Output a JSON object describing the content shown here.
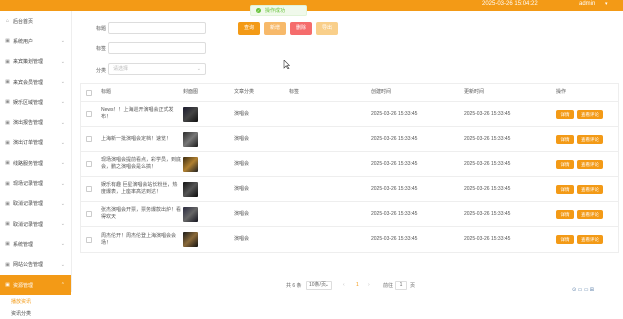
{
  "header": {
    "timestamp": "2025-03-26 15:04:22",
    "user": "admin",
    "caret": "▾"
  },
  "toast": {
    "icon": "✓",
    "message": "操作成功"
  },
  "sidebar": {
    "items": [
      {
        "icon": "⌂",
        "label": "后台首页"
      },
      {
        "icon": "▣",
        "label": "系统用户"
      },
      {
        "icon": "▣",
        "label": "来宾策划管理"
      },
      {
        "icon": "▣",
        "label": "来宾会员管理"
      },
      {
        "icon": "▣",
        "label": "娱乐区域管理"
      },
      {
        "icon": "▣",
        "label": "演出报告管理"
      },
      {
        "icon": "▣",
        "label": "演出订单管理"
      },
      {
        "icon": "▣",
        "label": "线路服务管理"
      },
      {
        "icon": "▣",
        "label": "现场记录管理"
      },
      {
        "icon": "▣",
        "label": "取消记录管理"
      },
      {
        "icon": "▣",
        "label": "取消记录管理"
      },
      {
        "icon": "▣",
        "label": "系统管理"
      },
      {
        "icon": "▣",
        "label": "网站公告管理"
      },
      {
        "icon": "▣",
        "label": "资源管理"
      }
    ],
    "subitems": [
      "播放资讯",
      "资讯分类"
    ]
  },
  "filters": {
    "title_label": "标题",
    "tag_label": "标签",
    "category_label": "分类",
    "category_placeholder": "请选择"
  },
  "buttons": {
    "search": "查询",
    "add": "新增",
    "delete": "删除",
    "export": "导出"
  },
  "table": {
    "columns": [
      "标题",
      "封面图",
      "文章分类",
      "标签",
      "创建时间",
      "更新时间",
      "操作"
    ],
    "rows": [
      {
        "title": "News！！上海巡开演唱会正式发布！",
        "category": "演唱会",
        "created": "2025-03-26 15:33:45",
        "updated": "2025-03-26 15:33:45"
      },
      {
        "title": "上海新一批演唱会定档！速览！",
        "category": "演唱会",
        "created": "2025-03-26 15:33:45",
        "updated": "2025-03-26 15:33:45"
      },
      {
        "title": "现场演唱会提前看点，彩学员，到底会，鹏之演唱会是么搞！",
        "category": "演唱会",
        "created": "2025-03-26 15:33:45",
        "updated": "2025-03-26 15:33:45"
      },
      {
        "title": "娱乐有趣 巨星演唱会站长粉丝，热度爆表，上座率高达到达！",
        "category": "演唱会",
        "created": "2025-03-26 15:33:45",
        "updated": "2025-03-26 15:33:45"
      },
      {
        "title": "张杰演唱会开票，票务爆款出炉！看得欢天",
        "category": "演唱会",
        "created": "2025-03-26 15:33:45",
        "updated": "2025-03-26 15:33:45"
      },
      {
        "title": "周杰伦开！周杰伦登上海演唱会会场！",
        "category": "演唱会",
        "created": "2025-03-26 15:33:45",
        "updated": "2025-03-26 15:33:45"
      }
    ],
    "action_detail": "详情",
    "action_comment": "查看评论"
  },
  "pager": {
    "total": "共 6 条",
    "page_size": "10条/页",
    "current": "1",
    "goto": "前往",
    "goto_page": "1",
    "page_unit": "页",
    "prev": "‹",
    "next": "›"
  },
  "corner": {
    "icons": "⊙ ▭ ▭ ⊞"
  },
  "colors": {
    "accent": "#f39a16",
    "delete": "#f56c6c",
    "add": "#f7b96a",
    "export": "#f9cf8a",
    "success": "#67c23a"
  }
}
